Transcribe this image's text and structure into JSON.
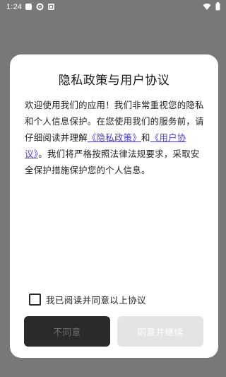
{
  "status_bar": {
    "time": "1:24"
  },
  "dialog": {
    "title": "隐私政策与用户协议",
    "body_before": "欢迎使用我们的应用！我们非常重视您的隐私和个人信息保护。在您使用我们的服务前，请仔细阅读并理解",
    "privacy_link": "《隐私政策》",
    "body_and": "和",
    "user_agreement_link": "《用户协议》",
    "body_after": "。我们将严格按照法律法规要求，采取安全保护措施保护您的个人信息。",
    "agree_checkbox_label": "我已阅读并同意以上协议",
    "agree_checked": false,
    "disagree_button": "不同意",
    "agree_button": "同意并继续"
  },
  "colors": {
    "overlay": "#787878",
    "link": "#4a3fe0",
    "disagree_bg": "#2a2a2a",
    "agree_disabled_bg": "#e4e4e4"
  }
}
